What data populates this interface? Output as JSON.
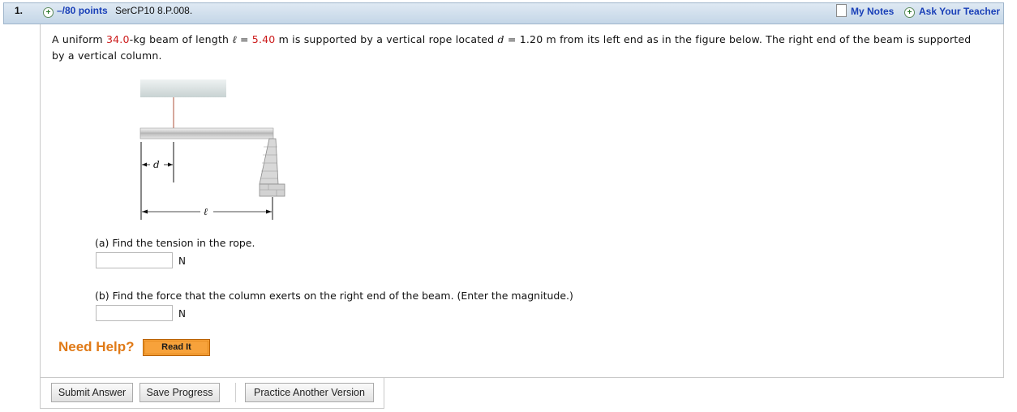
{
  "header": {
    "question_number": "1.",
    "points": "–/80 points",
    "problem_code": "SerCP10 8.P.008.",
    "my_notes": "My Notes",
    "ask_teacher": "Ask Your Teacher"
  },
  "problem": {
    "p1": "A uniform ",
    "mass": "34.0",
    "p2": "-kg beam of length ",
    "ell_symbol": "ℓ",
    "p3": " = ",
    "length": "5.40",
    "p4": " m  is supported by a vertical rope located ",
    "d_symbol": "d",
    "p5": " = 1.20 m  from its left end as in the figure below. The right end of the beam is supported by a vertical column."
  },
  "figure": {
    "d_label": "d",
    "ell_label": "ℓ"
  },
  "parts": [
    {
      "question": "(a) Find the tension in the rope.",
      "unit": "N",
      "value": ""
    },
    {
      "question": "(b) Find the force that the column exerts on the right end of the beam. (Enter the magnitude.)",
      "unit": "N",
      "value": ""
    }
  ],
  "help": {
    "label": "Need Help?",
    "read_it": "Read It"
  },
  "buttons": {
    "submit": "Submit Answer",
    "save": "Save Progress",
    "practice": "Practice Another Version"
  },
  "colors": {
    "highlight_red": "#cc1a1a",
    "link_blue": "#1a40b8",
    "help_orange": "#e07a17"
  }
}
